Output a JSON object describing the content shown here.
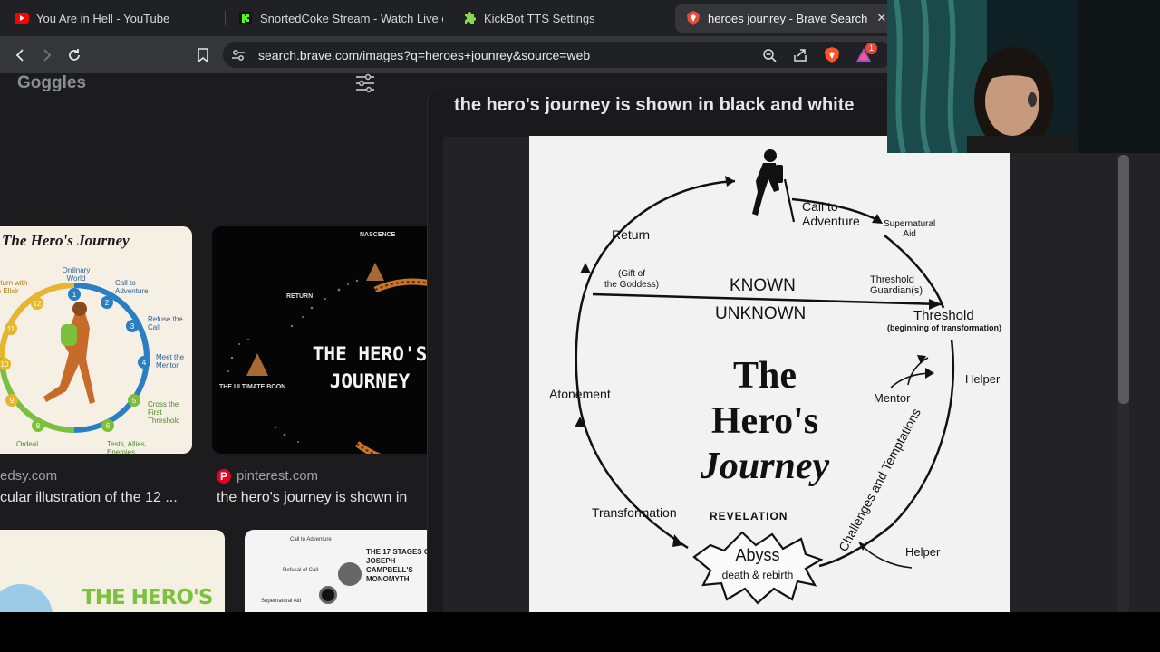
{
  "tabs": [
    {
      "label": "You Are in Hell - YouTube",
      "icon": "youtube-icon"
    },
    {
      "label": "SnortedCoke Stream - Watch Live on",
      "icon": "kick-icon"
    },
    {
      "label": "KickBot TTS Settings",
      "icon": "puzzle-icon"
    },
    {
      "label": "heroes jounrey - Brave Search",
      "icon": "brave-icon",
      "close": "✕"
    }
  ],
  "toolbar": {
    "url": "search.brave.com/images?q=heroes+jounrey&source=web",
    "shields_badge": "1"
  },
  "sidebar": {
    "goggles_label": "Goggles"
  },
  "results": [
    {
      "source": "edsy.com",
      "caption": "cular illustration of the 12 ...",
      "thumb_title": "The Hero's Journey"
    },
    {
      "source": "pinterest.com",
      "caption": "the hero's journey is shown in",
      "thumb_title": "THE HERO'S JOURNEY"
    }
  ],
  "thumb1": {
    "steps": [
      "Ordinary World",
      "Call to Adventure",
      "Refuse the Call",
      "Meet the Mentor",
      "Cross the First Threshold",
      "Tests, Allies, Enemies",
      "Ordeal",
      "Return with the Elixir"
    ],
    "numbers": [
      "1",
      "2",
      "3",
      "4",
      "5",
      "6",
      "7",
      "8",
      "9",
      "10",
      "11",
      "12"
    ]
  },
  "thumb2": {
    "labels": [
      "NASCENCE",
      "RETURN",
      "THE ULTIMATE BOON"
    ]
  },
  "thumb3": {
    "title": "THE HERO'S"
  },
  "thumb4": {
    "title": "THE 17 STAGES OF JOSEPH CAMPBELL'S MONOMYTH",
    "items": [
      "Call to Adventure",
      "Refusal of Call",
      "Supernatural Aid"
    ]
  },
  "preview": {
    "title": "the hero's journey is shown in black and white",
    "diagram": {
      "title_lines": [
        "The",
        "Hero's",
        "Journey"
      ],
      "known": "KNOWN",
      "unknown": "UNKNOWN",
      "call": [
        "Call to",
        "Adventure"
      ],
      "supernatural": [
        "Supernatural",
        "Aid"
      ],
      "threshold_guardians": [
        "Threshold",
        "Guardian(s)"
      ],
      "threshold": "Threshold",
      "threshold_sub": "(beginning of transformation)",
      "return": "Return",
      "gift": [
        "(Gift of",
        "the Goddess)"
      ],
      "helper_top": "Helper",
      "mentor": "Mentor",
      "atonement": "Atonement",
      "challenges": "Challenges and Temptations",
      "transformation": "Transformation",
      "revelation": "REVELATION",
      "abyss": "Abyss",
      "death": "death & rebirth",
      "helper_bottom": "Helper"
    }
  }
}
